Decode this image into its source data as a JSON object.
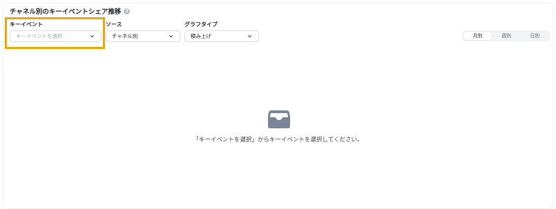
{
  "header": {
    "title": "チャネル別のキーイベントシェア推移",
    "help_icon": "question-circle-icon"
  },
  "filters": {
    "key_event": {
      "label": "キーイベント",
      "placeholder": "キーイベントを選択",
      "value": ""
    },
    "source": {
      "label": "ソース",
      "value": "チャネル別"
    },
    "graph_type": {
      "label": "グラフタイプ",
      "value": "積み上げ"
    }
  },
  "period_toggle": {
    "options": [
      "月別",
      "週別",
      "日別"
    ],
    "selected": "月別"
  },
  "empty_state": {
    "icon": "inbox-tray-icon",
    "message": "「キーイベントを選択」からキーイベントを選択してください。"
  },
  "colors": {
    "highlight": "#f0a500",
    "icon": "#7b8494"
  }
}
